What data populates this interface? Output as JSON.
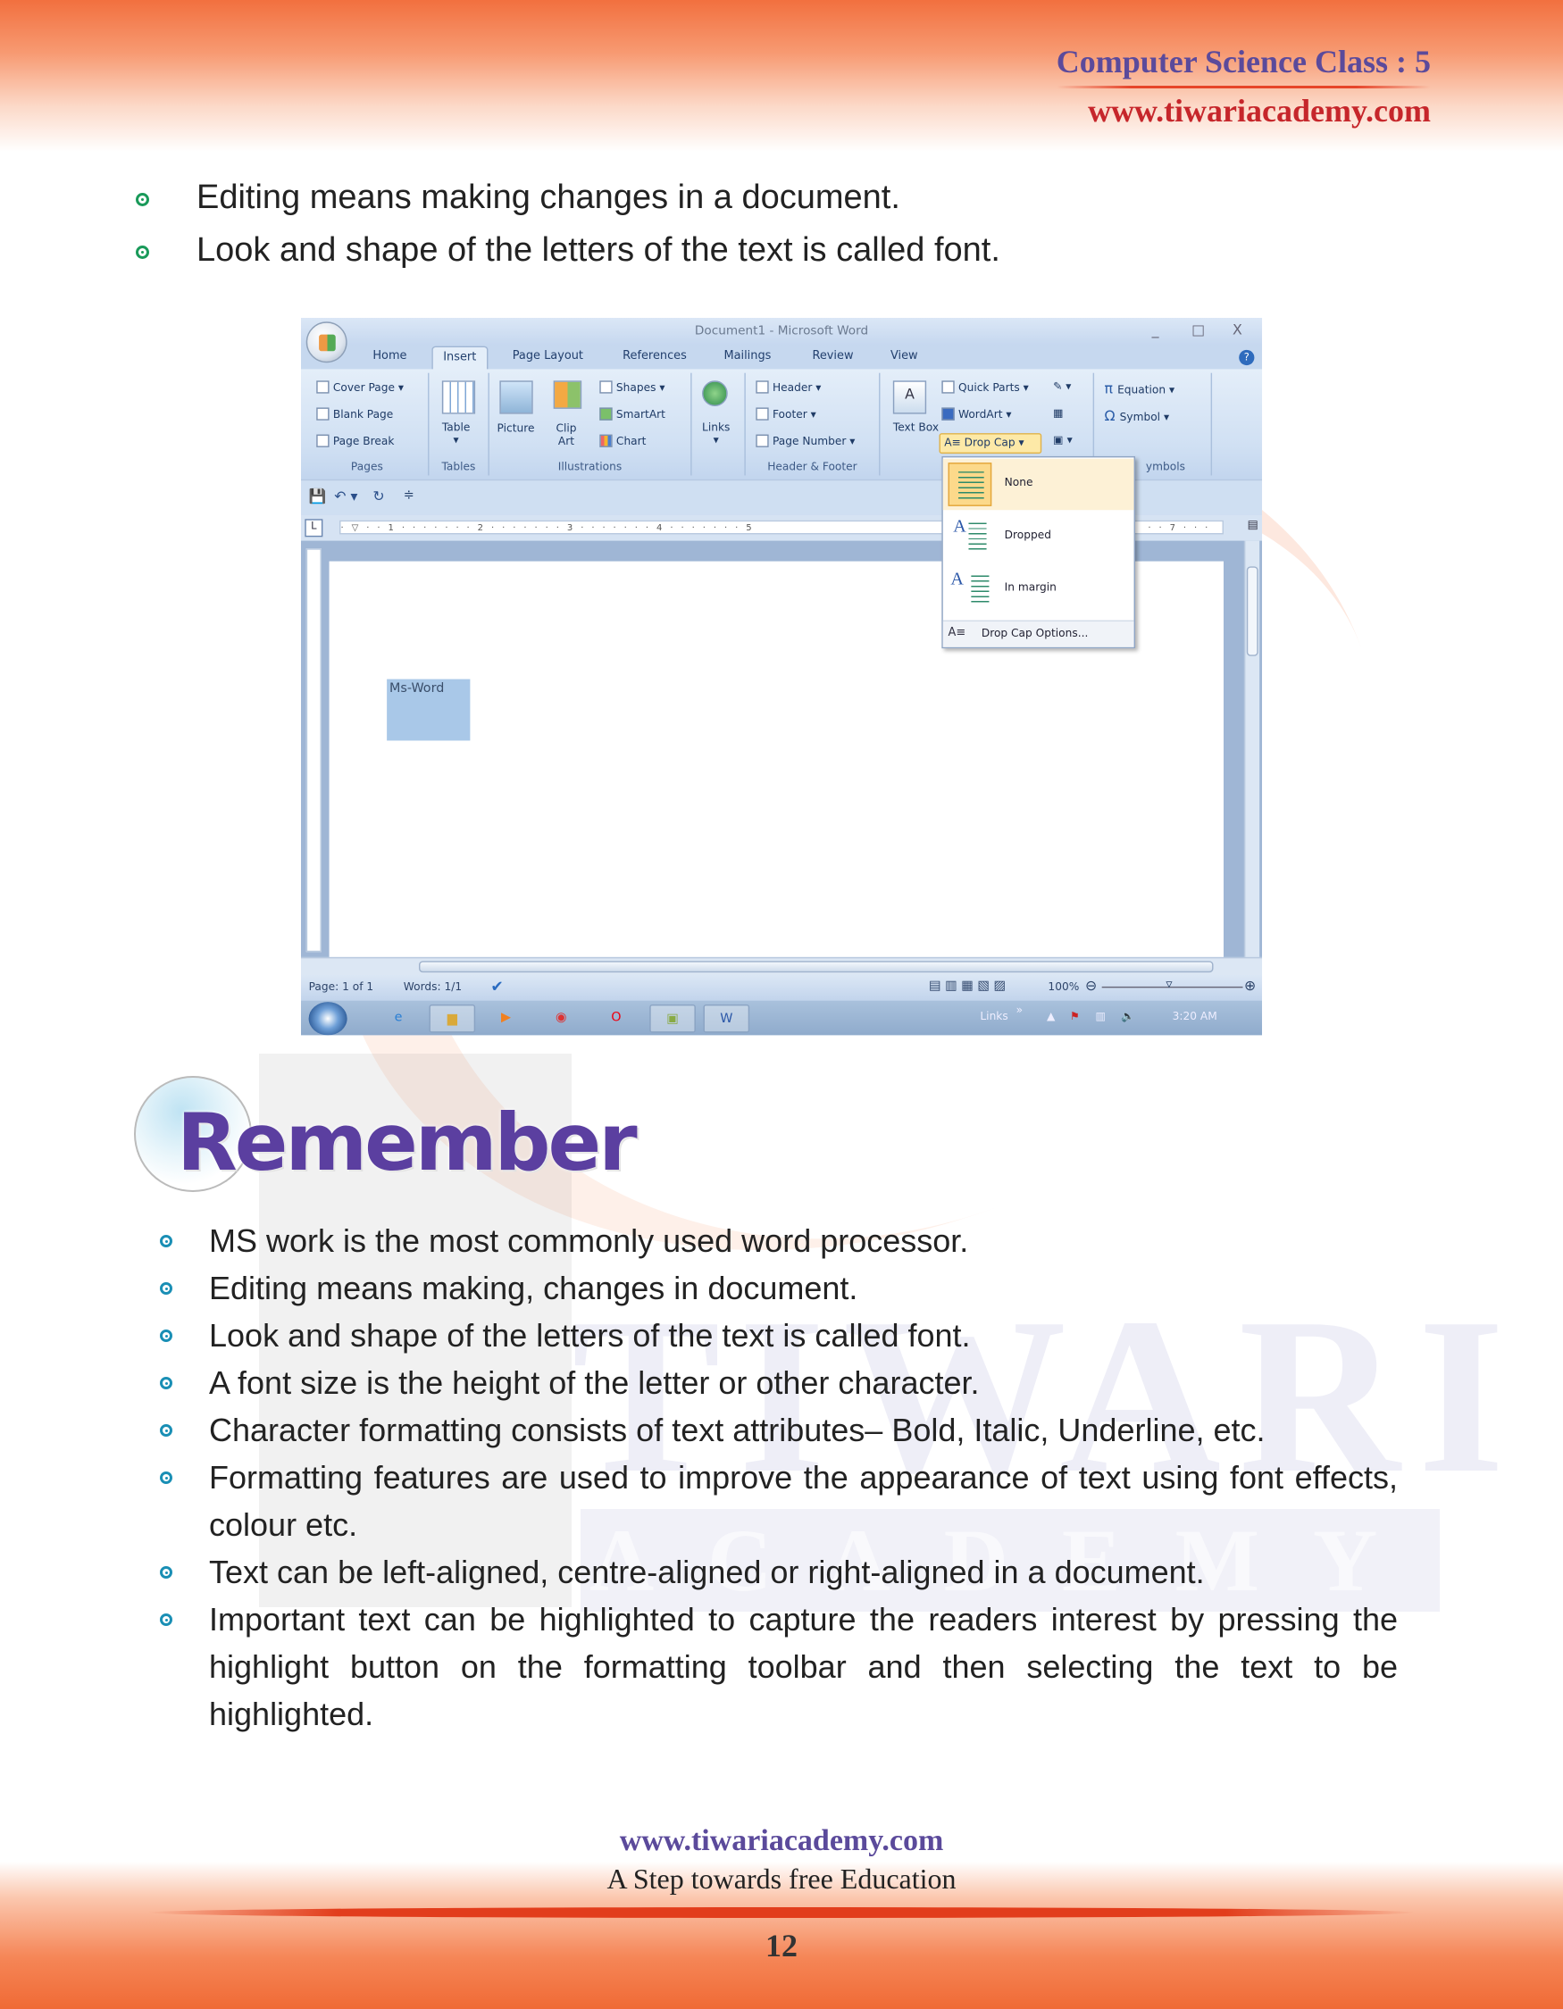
{
  "header": {
    "subject": "Computer Science Class : 5",
    "website": "www.tiwariacademy.com"
  },
  "watermark": {
    "line1": "TIWARI",
    "line2": "ACADEMY"
  },
  "intro_points": [
    "Editing means making changes in a document.",
    "Look and shape of the letters of the text is called font."
  ],
  "word_window": {
    "title": "Document1 - Microsoft Word",
    "controls": [
      "_",
      "□",
      "X"
    ],
    "tabs": [
      "Home",
      "Insert",
      "Page Layout",
      "References",
      "Mailings",
      "Review",
      "View"
    ],
    "active_tab": "Insert",
    "groups": {
      "pages": {
        "label": "Pages",
        "items": [
          "Cover Page",
          "Blank Page",
          "Page Break"
        ]
      },
      "tables": {
        "label": "Tables",
        "items": [
          "Table"
        ]
      },
      "illustrations": {
        "label": "Illustrations",
        "items": [
          "Picture",
          "Clip Art",
          "Shapes",
          "SmartArt",
          "Chart"
        ]
      },
      "links": {
        "label": "",
        "items": [
          "Links"
        ]
      },
      "header_footer": {
        "label": "Header & Footer",
        "items": [
          "Header",
          "Footer",
          "Page Number"
        ]
      },
      "text": {
        "label": "",
        "items": [
          "Text Box",
          "Quick Parts",
          "WordArt",
          "Drop Cap"
        ]
      },
      "symbols": {
        "label": "ymbols",
        "items": [
          "Equation",
          "Symbol"
        ]
      }
    },
    "ruler_marks": "· ▽ · · 1 · · · · · · · 2 · · · · · · · 3 · · · · · · · 4 · · · · · · · 5",
    "ruler_right": "· · 7 · · ·",
    "document_text": "Ms-Word",
    "dropcap_menu": {
      "items": [
        "None",
        "Dropped",
        "In margin"
      ],
      "selected": "None",
      "options": "Drop Cap Options..."
    },
    "status": {
      "page": "Page: 1 of 1",
      "words": "Words: 1/1",
      "zoom": "100%"
    },
    "taskbar": {
      "links": "Links",
      "time": "3:20 AM"
    },
    "accent_color": "#fcd98a"
  },
  "remember": {
    "title": "Remember",
    "points": [
      "MS work is the most commonly used word processor.",
      "Editing means making, changes in document.",
      "Look and shape of the letters of the text is called font.",
      "A font size is the height of the letter or other character.",
      "Character formatting consists of text attributes– Bold, Italic, Underline, etc.",
      "Formatting features are used to improve the appearance of text using font effects, colour etc.",
      "Text can be left-aligned, centre-aligned or right-aligned in a document.",
      "Important text can be highlighted to capture the readers interest by pressing the highlight button on the formatting toolbar and then selecting the text to be highlighted."
    ]
  },
  "footer": {
    "website": "www.tiwariacademy.com",
    "tagline": "A Step towards free Education",
    "page_number": "12"
  },
  "colors": {
    "header_purple": "#5b4a9b",
    "header_red": "#c6262b",
    "band_orange": "#f06a35",
    "bullet_green": "#1a9a5a",
    "remember_purple": "#5b3fa0"
  }
}
